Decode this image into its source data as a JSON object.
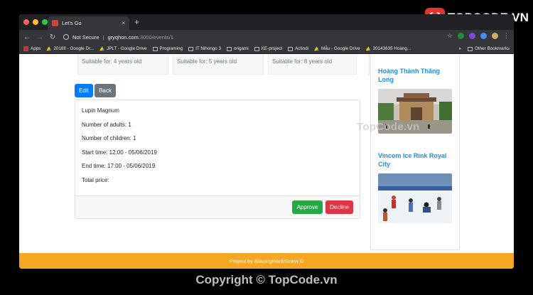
{
  "logo": {
    "mark": "{;}",
    "text": "TOPCODE.VN"
  },
  "browser": {
    "tab_title": "Let's Go",
    "tab_close": "×",
    "new_tab": "+",
    "security": "Not Secure",
    "url_host": "gryqhon.com",
    "url_path": ":3000/events/1"
  },
  "bookmarks": {
    "items": [
      "Apps",
      "2018II - Google Dr...",
      "JPLT - Google Drive",
      "Programing",
      "IT Nihongo 3",
      "origami",
      "KE-project",
      "Actindi",
      "Mẫu - Google Drive",
      "20143635 Hoàng..."
    ],
    "more": "»",
    "other": "Other Bookmarks"
  },
  "suitable": [
    "Suitable for: 4 years old",
    "Suitable for: 5 years old",
    "Suitable for: 8 years old"
  ],
  "actions": {
    "edit": "Edit",
    "back": "Back"
  },
  "event": {
    "name": "Lupin Magnum",
    "adults": "Number of adults: 1",
    "children": "Number of children: 1",
    "start": "Start time: 12:00 - 05/06/2019",
    "end": "End time: 17:00 - 05/06/2019",
    "price": "Total price:",
    "approve": "Approve",
    "decline": "Decline"
  },
  "sidebar": {
    "places": [
      {
        "title": "Hoàng Thành Thăng Long"
      },
      {
        "title": "Vincom Ice Rink Royal City"
      }
    ]
  },
  "footer": {
    "text": "Project by BlazingRockStorm ©"
  },
  "watermark": "TopCode.vn",
  "copyright": "Copyright © TopCode.vn",
  "colors": {
    "primary": "#007bff",
    "success": "#28a745",
    "danger": "#dc3545",
    "footer": "#f5a623",
    "link": "#1b8fe6"
  }
}
